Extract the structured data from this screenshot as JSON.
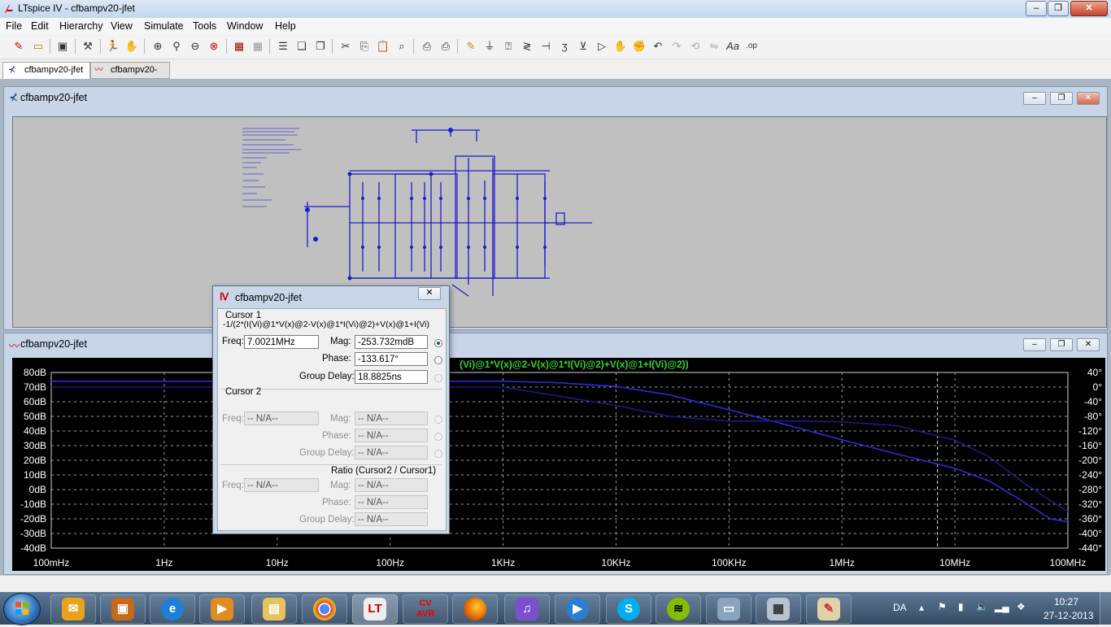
{
  "app": {
    "title": "LTspice IV - cfbampv20-jfet"
  },
  "menu": [
    "File",
    "Edit",
    "Hierarchy",
    "View",
    "Simulate",
    "Tools",
    "Window",
    "Help"
  ],
  "toolbar_icons": [
    "new-schematic-icon",
    "open-icon",
    "save-icon",
    "control-panel-icon",
    "run-icon",
    "halt-icon",
    "zoom-in-icon",
    "zoom-pan-icon",
    "zoom-out-icon",
    "zoom-cancel-icon",
    "autorange-icon",
    "grid-icon",
    "tile-horizontal-icon",
    "cascade-icon",
    "close-all-icon",
    "cut-icon",
    "copy-icon",
    "paste-icon",
    "find-icon",
    "print-setup-icon",
    "print-icon",
    "draw-wire-icon",
    "ground-icon",
    "label-net-icon",
    "resistor-icon",
    "capacitor-icon",
    "inductor-icon",
    "diode-icon",
    "component-icon",
    "move-icon",
    "drag-icon",
    "undo-icon",
    "redo-icon",
    "rotate-icon",
    "mirror-icon",
    "text-icon",
    "spice-directive-icon"
  ],
  "tabs": [
    {
      "label": "cfbampv20-jfet",
      "icon": "schematic-icon"
    },
    {
      "label": "cfbampv20-jfet",
      "icon": "waveform-icon"
    }
  ],
  "schematic_window": {
    "title": "cfbampv20-jfet"
  },
  "waveform_window": {
    "title": "cfbampv20-jfet",
    "trace_label": "(Vi)@1*V(x)@2-V(x)@1*I(Vi)@2)+V(x)@1+I(Vi)@2))"
  },
  "dialog": {
    "title": "cfbampv20-jfet",
    "cursor1": {
      "heading": "Cursor 1",
      "expression": "-1/(2*(I(Vi)@1*V(x)@2-V(x)@1*I(Vi)@2)+V(x)@1+I(Vi)",
      "freq_label": "Freq:",
      "freq": "7.0021MHz",
      "mag_label": "Mag:",
      "mag": "-253.732mdB",
      "phase_label": "Phase:",
      "phase": "-133.617°",
      "gd_label": "Group Delay:",
      "gd": "18.8825ns"
    },
    "cursor2": {
      "heading": "Cursor 2",
      "freq_label": "Freq:",
      "freq": "-- N/A--",
      "mag_label": "Mag:",
      "mag": "-- N/A--",
      "phase_label": "Phase:",
      "phase": "-- N/A--",
      "gd_label": "Group Delay:",
      "gd": "-- N/A--"
    },
    "ratio": {
      "heading": "Ratio (Cursor2 / Cursor1)",
      "freq_label": "Freq:",
      "freq": "-- N/A--",
      "mag_label": "Mag:",
      "mag": "-- N/A--",
      "phase_label": "Phase:",
      "phase": "-- N/A--",
      "gd_label": "Group Delay:",
      "gd": "-- N/A--"
    }
  },
  "chart_data": {
    "type": "line",
    "xscale": "log",
    "xlim": [
      0.1,
      100000000
    ],
    "x_ticks": [
      "100mHz",
      "1Hz",
      "10Hz",
      "100Hz",
      "1KHz",
      "10KHz",
      "100KHz",
      "1MHz",
      "10MHz",
      "100MHz"
    ],
    "ylim_left": [
      -40,
      80
    ],
    "y_left_ticks": [
      "80dB",
      "70dB",
      "60dB",
      "50dB",
      "40dB",
      "30dB",
      "20dB",
      "10dB",
      "0dB",
      "-10dB",
      "-20dB",
      "-30dB",
      "-40dB"
    ],
    "ylim_right": [
      -440,
      40
    ],
    "y_right_ticks": [
      "40°",
      "0°",
      "-40°",
      "-80°",
      "-120°",
      "-160°",
      "-200°",
      "-240°",
      "-280°",
      "-320°",
      "-360°",
      "-400°",
      "-440°"
    ],
    "grid": true,
    "cursor_x": 7002100,
    "series": [
      {
        "axis": "left",
        "color": "#2b2bd6",
        "x": [
          0.1,
          1,
          10,
          100,
          1000,
          3000,
          10000,
          30000,
          100000,
          300000,
          1000000,
          3000000,
          10000000,
          20000000,
          40000000,
          70000000,
          100000000
        ],
        "values": [
          74,
          74,
          74,
          74,
          74,
          73,
          70.5,
          64.6,
          54.5,
          44.9,
          34,
          24.5,
          14.5,
          6,
          -8,
          -20,
          -22
        ]
      },
      {
        "axis": "right",
        "color": "#1a1a8c",
        "x": [
          0.1,
          1000,
          10000,
          30000,
          100000,
          300000,
          1000000,
          3000000,
          10000000,
          20000000,
          40000000,
          70000000,
          100000000
        ],
        "values": [
          0,
          0,
          -50,
          -80,
          -93,
          -92,
          -95,
          -105,
          -145,
          -190,
          -260,
          -310,
          -340
        ]
      }
    ]
  },
  "taskbar": {
    "items": [
      "outlook-icon",
      "installer-icon",
      "ie-icon",
      "media-center-icon",
      "explorer-icon",
      "chrome-icon",
      "ltspice-icon",
      "cvavr-icon",
      "firefox-icon",
      "itunes-icon",
      "mediaplayer-icon",
      "skype-icon",
      "spotify-icon",
      "remote-icon",
      "calculator-icon",
      "paint-icon"
    ],
    "cvavr_text": "CV AVR",
    "lang": "DA",
    "time": "10:27",
    "date": "27-12-2013"
  }
}
